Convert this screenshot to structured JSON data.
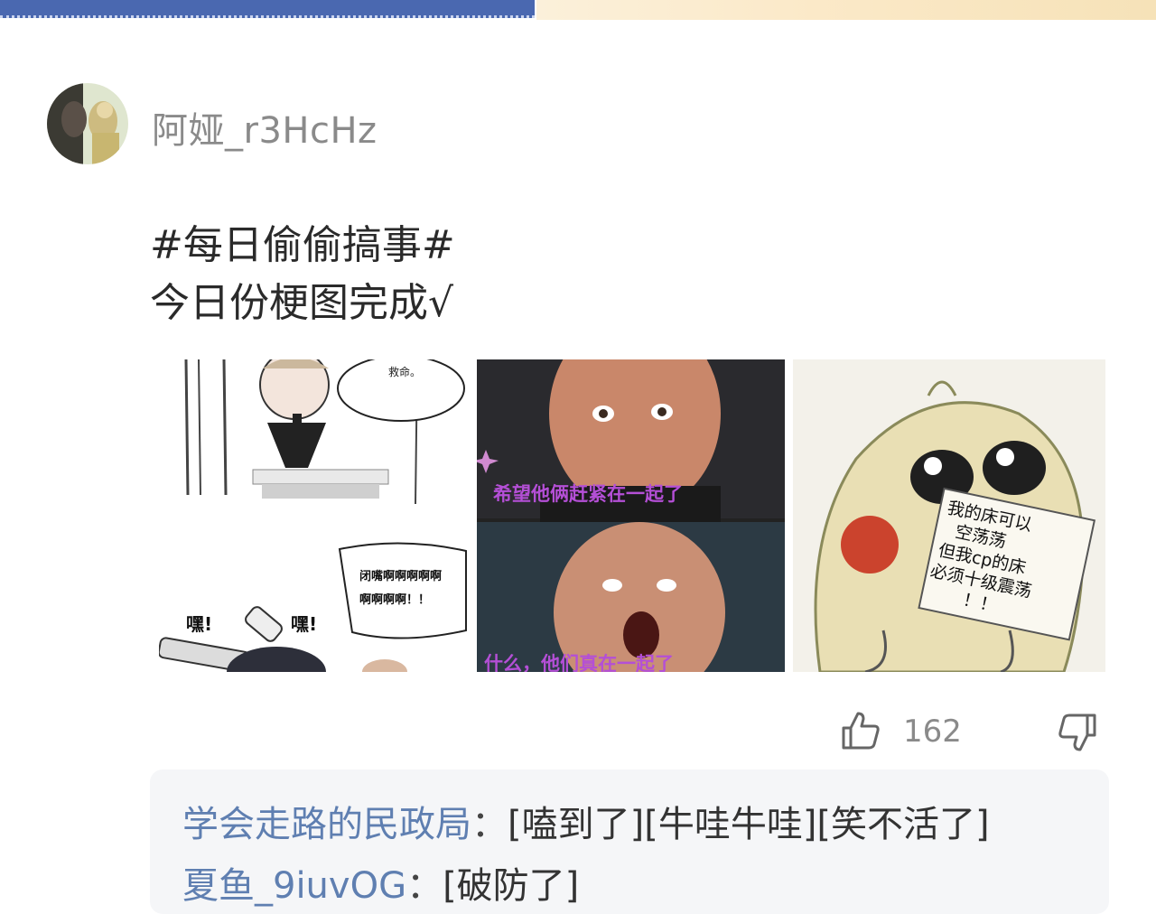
{
  "post": {
    "username": "阿娅_r3HcHz",
    "text_line1": "#每日偷偷搞事#",
    "text_line2": "今日份梗图完成√"
  },
  "images": {
    "img1": {
      "bubble_top": "救命。",
      "bubble_bottom": "闭嘴啊啊啊啊啊啊啊啊啊！！",
      "sfx_left": "嘿!",
      "sfx_right": "嘿!"
    },
    "img2": {
      "caption_top": "希望他俩赶紧在一起了",
      "caption_bottom": "什么，他们真在一起了"
    },
    "img3": {
      "sign_line1": "我的床可以",
      "sign_line2": "空荡荡",
      "sign_line3": "但我cp的床",
      "sign_line4": "必须十级震荡",
      "sign_line5": "！！"
    }
  },
  "actions": {
    "like_icon": "thumbs-up-icon",
    "like_count": "162",
    "dislike_icon": "thumbs-down-icon"
  },
  "replies": [
    {
      "name": "学会走路的民政局",
      "sep": "：",
      "text": "[嗑到了][牛哇牛哇][笑不活了]"
    },
    {
      "name": "夏鱼_9iuvOG",
      "sep": "：",
      "text": "[破防了]"
    }
  ],
  "colors": {
    "top_bar_blue": "#4a68b0",
    "reply_name": "#5f7fb1",
    "meme_caption": "#b44fd6"
  }
}
